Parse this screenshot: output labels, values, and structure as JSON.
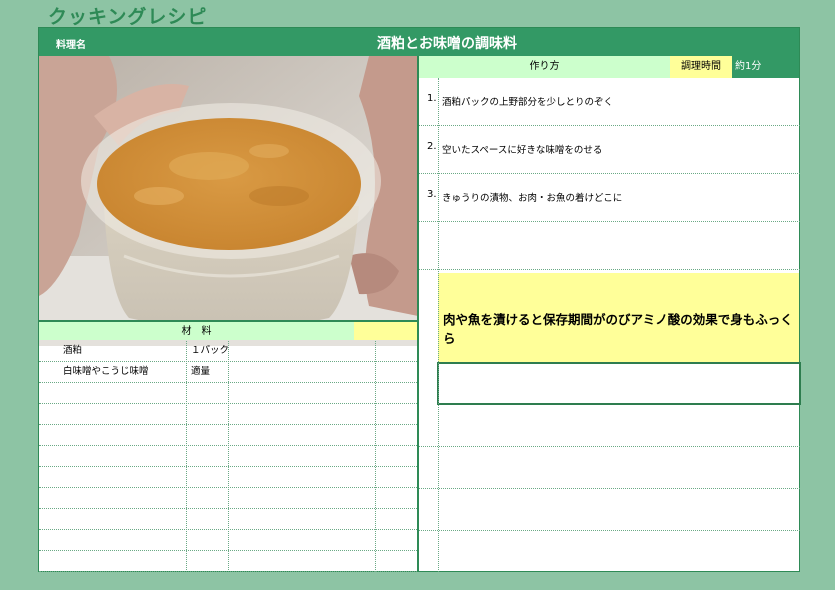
{
  "app": {
    "title": "クッキングレシピ"
  },
  "header": {
    "dish_label": "料理名",
    "dish_name": "酒粕とお味噌の調味料"
  },
  "photo": {
    "description_icon": "recipe-photo"
  },
  "ingredients": {
    "header": "材　料",
    "rows": [
      {
        "name": "酒粕",
        "qty": "１パック"
      },
      {
        "name": "白味噌やこうじ味噌",
        "qty": "適量"
      },
      {
        "name": "",
        "qty": ""
      },
      {
        "name": "",
        "qty": ""
      },
      {
        "name": "",
        "qty": ""
      },
      {
        "name": "",
        "qty": ""
      },
      {
        "name": "",
        "qty": ""
      },
      {
        "name": "",
        "qty": ""
      },
      {
        "name": "",
        "qty": ""
      },
      {
        "name": "",
        "qty": ""
      },
      {
        "name": "",
        "qty": ""
      }
    ]
  },
  "steps": {
    "header": "作り方",
    "time_label": "調理時間",
    "time_value": "約1分",
    "items": [
      {
        "num": "1.",
        "text": "酒粕パックの上野部分を少しとりのぞく"
      },
      {
        "num": "2.",
        "text": "空いたスペースに好きな味噌をのせる"
      },
      {
        "num": "3.",
        "text": "きゅうりの漬物、お肉・お魚の着けどこに"
      },
      {
        "num": "",
        "text": ""
      }
    ],
    "tip": "肉や魚を漬けると保存期間がのびアミノ酸の効果で身もふっくら"
  },
  "colors": {
    "accent": "#339965",
    "background": "#8dc4a4",
    "highlight_yellow": "#ffff99",
    "highlight_green": "#ccffcc"
  }
}
